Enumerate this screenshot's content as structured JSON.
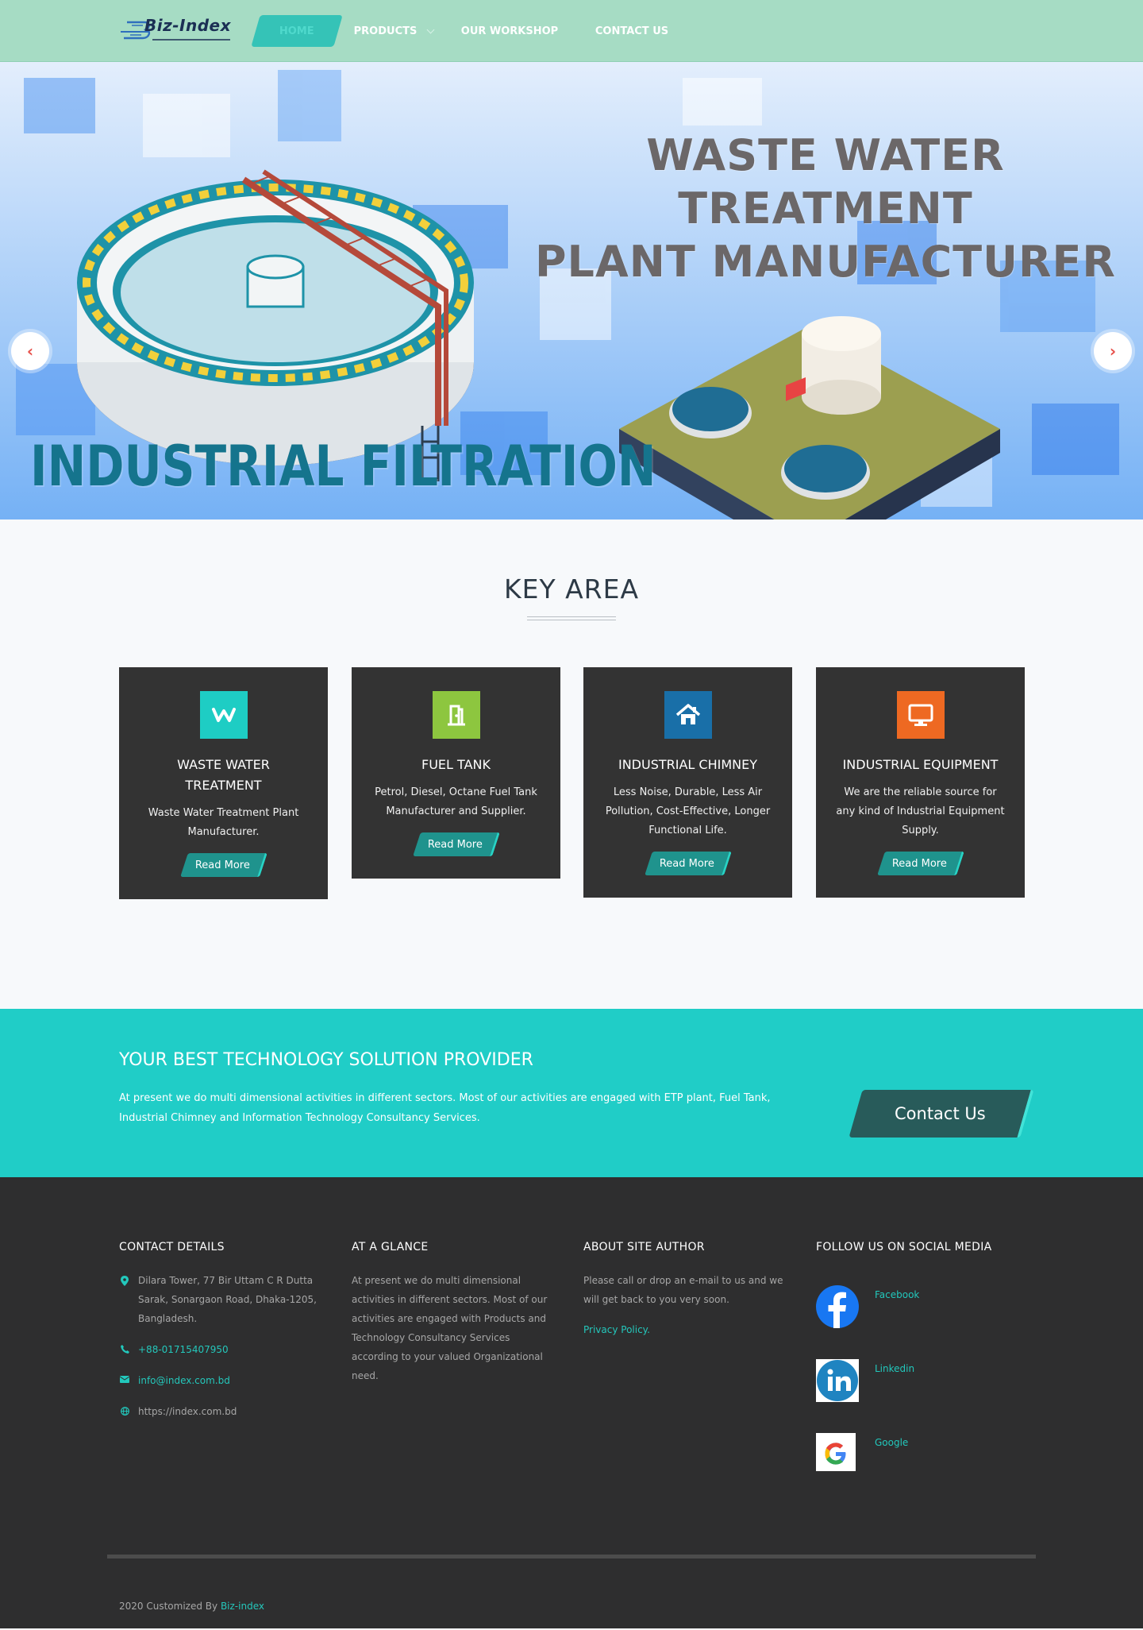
{
  "brand": {
    "logo_text": "Biz-Index"
  },
  "nav": {
    "home": "HOME",
    "products": "PRODUCTS",
    "workshop": "OUR WORKSHOP",
    "contact": "CONTACT US"
  },
  "hero": {
    "title_line1": "WASTE WATER TREATMENT",
    "title_line2": "PLANT MANUFACTURER",
    "subtitle": "INDUSTRIAL FILTRATION",
    "arrow_prev_icon": "chevron-left-icon",
    "arrow_next_icon": "chevron-right-icon",
    "slides": 5,
    "active_slide": 1
  },
  "key_area": {
    "title": "KEY AREA",
    "cards": [
      {
        "icon": "weebly-icon",
        "color": "#1ecdc4",
        "title": "WASTE WATER TREATMENT",
        "text": "Waste Water Treatment Plant Manufacturer.",
        "button": "Read More"
      },
      {
        "icon": "door-icon",
        "color": "#8dc63f",
        "title": "FUEL TANK",
        "text": "Petrol, Diesel, Octane Fuel Tank Manufacturer and Supplier.",
        "button": "Read More"
      },
      {
        "icon": "house-icon",
        "color": "#196fa8",
        "title": "INDUSTRIAL CHIMNEY",
        "text": "Less Noise, Durable, Less Air Pollution, Cost-Effective, Longer Functional Life.",
        "button": "Read More"
      },
      {
        "icon": "monitor-icon",
        "color": "#ee6922",
        "title": "INDUSTRIAL EQUIPMENT",
        "text": "We are the reliable source for any kind of Industrial Equipment Supply.",
        "button": "Read More"
      }
    ]
  },
  "cta": {
    "title": "YOUR BEST TECHNOLOGY SOLUTION PROVIDER",
    "text": "At present we do multi dimensional activities in different sectors. Most of our activities are engaged with ETP plant, Fuel Tank, Industrial Chimney and Information Technology Consultancy Services.",
    "button": "Contact Us"
  },
  "footer": {
    "contact": {
      "title": "CONTACT DETAILS",
      "address": "Dilara Tower, 77 Bir Uttam C R Dutta Sarak, Sonargaon Road, Dhaka-1205, Bangladesh.",
      "phone": "+88-01715407950",
      "email": "info@index.com.bd",
      "website": "https://index.com.bd"
    },
    "glance": {
      "title": "AT A GLANCE",
      "text": "At present we do multi dimensional activities in different sectors. Most of our activities are engaged with Products and Technology Consultancy Services according to your valued Organizational need."
    },
    "author": {
      "title": "ABOUT SITE AUTHOR",
      "text": "Please call or drop an e-mail to us and we will get back to you very soon.",
      "privacy": "Privacy Policy."
    },
    "social": {
      "title": "FOLLOW US ON SOCIAL MEDIA",
      "items": [
        {
          "label": "Facebook",
          "icon": "facebook-icon"
        },
        {
          "label": "Linkedin",
          "icon": "linkedin-icon"
        },
        {
          "label": "Google",
          "icon": "google-icon"
        }
      ]
    },
    "copyright_prefix": "2020 Customized By",
    "copyright_link": "Biz-index"
  }
}
